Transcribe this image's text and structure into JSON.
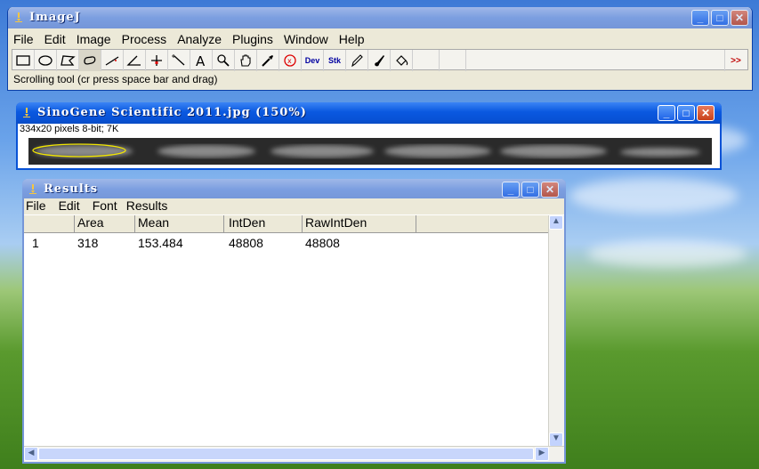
{
  "imagej": {
    "title": "ImageJ",
    "menu": [
      "File",
      "Edit",
      "Image",
      "Process",
      "Analyze",
      "Plugins",
      "Window",
      "Help"
    ],
    "tools": [
      {
        "name": "rectangle-tool-icon"
      },
      {
        "name": "oval-tool-icon"
      },
      {
        "name": "polygon-tool-icon"
      },
      {
        "name": "freehand-tool-icon"
      },
      {
        "name": "line-tool-icon"
      },
      {
        "name": "angle-tool-icon"
      },
      {
        "name": "point-tool-icon"
      },
      {
        "name": "wand-tool-icon"
      },
      {
        "name": "text-tool-icon"
      },
      {
        "name": "magnifier-tool-icon"
      },
      {
        "name": "scroll-tool-icon"
      },
      {
        "name": "color-picker-icon"
      },
      {
        "name": "stop-icon"
      },
      {
        "name": "dev-menu-icon",
        "label": "Dev"
      },
      {
        "name": "stk-menu-icon",
        "label": "Stk"
      },
      {
        "name": "pencil-tool-icon"
      },
      {
        "name": "brush-tool-icon"
      },
      {
        "name": "flood-fill-icon"
      },
      {
        "name": "blank-tool-1"
      },
      {
        "name": "blank-tool-2"
      },
      {
        "name": "more-tools-icon",
        "label": ">>"
      }
    ],
    "status": "Scrolling tool (cr press space bar and drag)"
  },
  "image_window": {
    "title": "SinoGene Scientific 2011.jpg (150%)",
    "info": "334x20 pixels 8-bit; 7K"
  },
  "results_window": {
    "title": "Results",
    "menu": [
      "File",
      "Edit",
      "Font",
      "Results"
    ],
    "columns": [
      "",
      "Area",
      "Mean",
      "IntDen",
      "RawIntDen"
    ],
    "rows": [
      [
        "1",
        "318",
        "153.484",
        "48808",
        "48808"
      ]
    ]
  },
  "colors": {
    "xp_blue": "#0852d6",
    "window_face": "#ece9d8",
    "selection_yellow": "#f2e600"
  }
}
